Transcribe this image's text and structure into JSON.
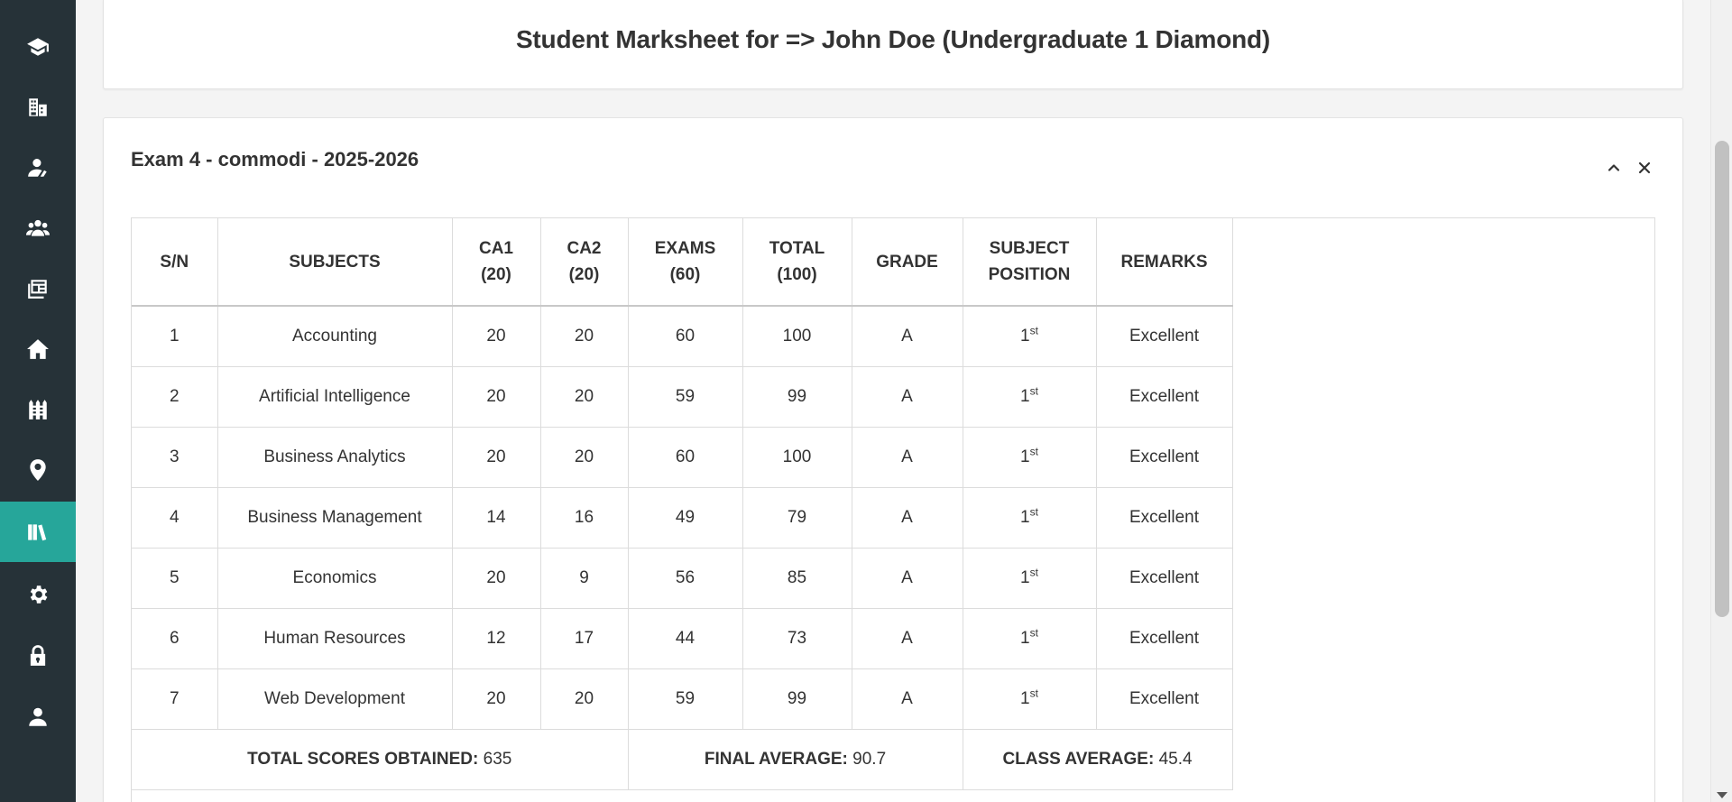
{
  "sidebar": {
    "items": [
      {
        "icon": "graduation-cap-icon",
        "active": false
      },
      {
        "icon": "school-building-icon",
        "active": false
      },
      {
        "icon": "teacher-icon",
        "active": false
      },
      {
        "icon": "students-group-icon",
        "active": false
      },
      {
        "icon": "classes-icon",
        "active": false
      },
      {
        "icon": "home-icon",
        "active": false
      },
      {
        "icon": "fence-icon",
        "active": false
      },
      {
        "icon": "location-pin-icon",
        "active": false
      },
      {
        "icon": "books-icon",
        "active": true
      },
      {
        "icon": "gear-icon",
        "active": false
      },
      {
        "icon": "lock-icon",
        "active": false
      },
      {
        "icon": "user-icon",
        "active": false
      }
    ],
    "active_color": "#26a69a",
    "background": "#263238"
  },
  "page": {
    "title": "Student Marksheet for => John Doe (Undergraduate 1 Diamond)"
  },
  "exam": {
    "title": "Exam 4 - commodi - 2025-2026",
    "columns": {
      "sn": "S/N",
      "subjects": "SUBJECTS",
      "ca1": "CA1",
      "ca1_max": "(20)",
      "ca2": "CA2",
      "ca2_max": "(20)",
      "exams": "EXAMS",
      "exams_max": "(60)",
      "total": "TOTAL",
      "total_max": "(100)",
      "grade": "GRADE",
      "subject": "SUBJECT",
      "position": "POSITION",
      "remarks": "REMARKS"
    },
    "rows": [
      {
        "sn": "1",
        "subject": "Accounting",
        "ca1": "20",
        "ca2": "20",
        "exams": "60",
        "total": "100",
        "grade": "A",
        "position": "1",
        "position_suffix": "st",
        "remarks": "Excellent"
      },
      {
        "sn": "2",
        "subject": "Artificial Intelligence",
        "ca1": "20",
        "ca2": "20",
        "exams": "59",
        "total": "99",
        "grade": "A",
        "position": "1",
        "position_suffix": "st",
        "remarks": "Excellent"
      },
      {
        "sn": "3",
        "subject": "Business Analytics",
        "ca1": "20",
        "ca2": "20",
        "exams": "60",
        "total": "100",
        "grade": "A",
        "position": "1",
        "position_suffix": "st",
        "remarks": "Excellent"
      },
      {
        "sn": "4",
        "subject": "Business Management",
        "ca1": "14",
        "ca2": "16",
        "exams": "49",
        "total": "79",
        "grade": "A",
        "position": "1",
        "position_suffix": "st",
        "remarks": "Excellent"
      },
      {
        "sn": "5",
        "subject": "Economics",
        "ca1": "20",
        "ca2": "9",
        "exams": "56",
        "total": "85",
        "grade": "A",
        "position": "1",
        "position_suffix": "st",
        "remarks": "Excellent"
      },
      {
        "sn": "6",
        "subject": "Human Resources",
        "ca1": "12",
        "ca2": "17",
        "exams": "44",
        "total": "73",
        "grade": "A",
        "position": "1",
        "position_suffix": "st",
        "remarks": "Excellent"
      },
      {
        "sn": "7",
        "subject": "Web Development",
        "ca1": "20",
        "ca2": "20",
        "exams": "59",
        "total": "99",
        "grade": "A",
        "position": "1",
        "position_suffix": "st",
        "remarks": "Excellent"
      }
    ],
    "summary": {
      "total_label": "TOTAL SCORES OBTAINED:",
      "total_value": "635",
      "final_label": "FINAL AVERAGE:",
      "final_value": "90.7",
      "class_label": "CLASS AVERAGE:",
      "class_value": "45.4"
    }
  }
}
